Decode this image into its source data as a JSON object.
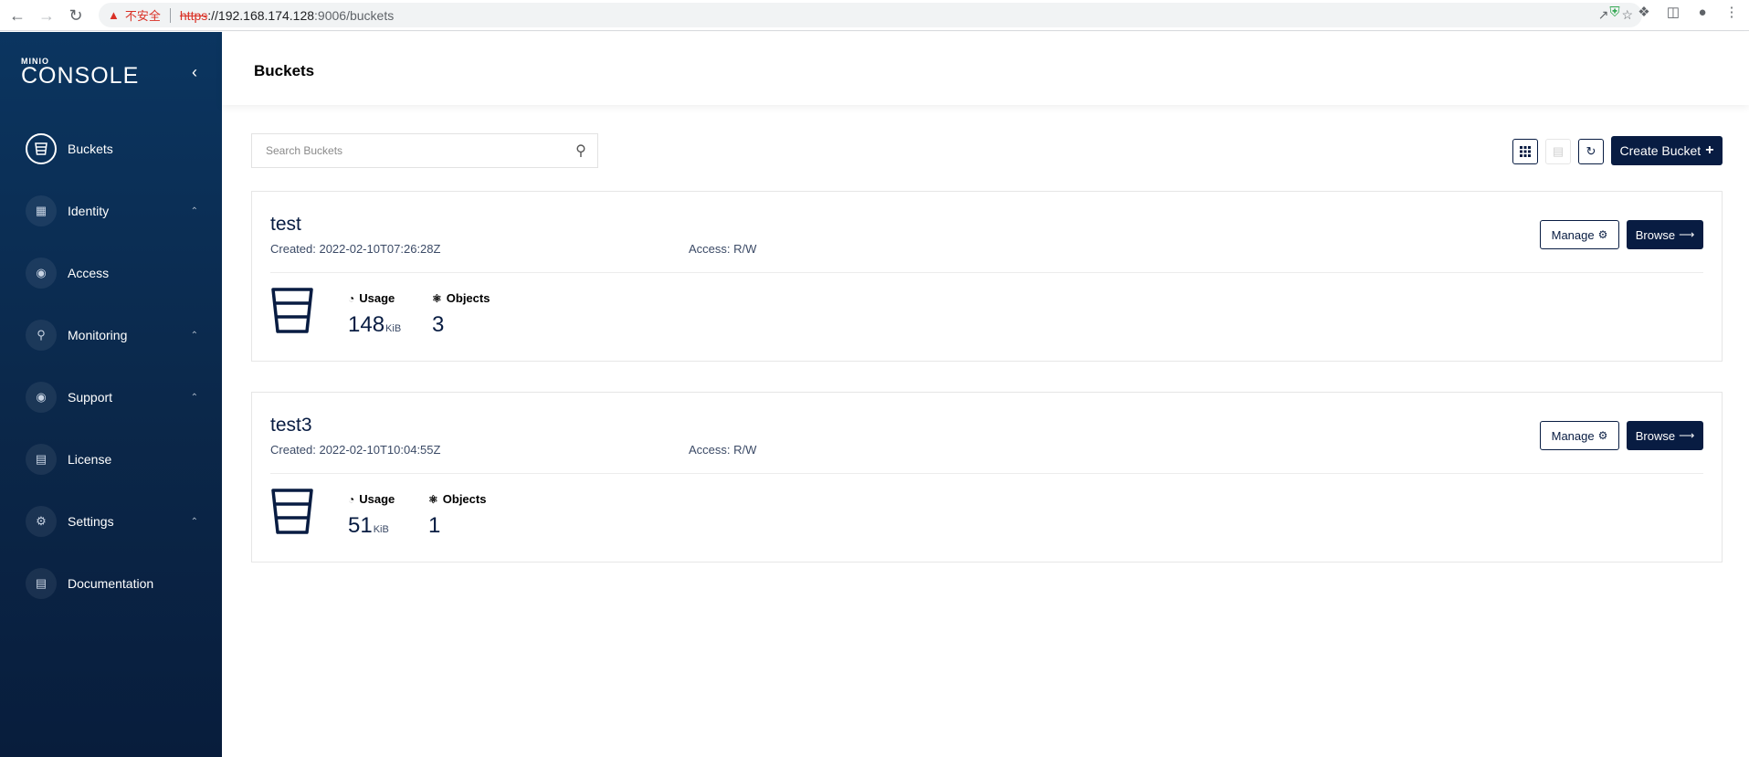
{
  "browser": {
    "insecure_label": "不安全",
    "url_scheme": "https",
    "url_host": "://192.168.174.128",
    "url_path": ":9006/buckets"
  },
  "sidebar": {
    "logo_small": "MINIO",
    "logo_big": "CONSOLE",
    "items": [
      {
        "label": "Buckets"
      },
      {
        "label": "Identity"
      },
      {
        "label": "Access"
      },
      {
        "label": "Monitoring"
      },
      {
        "label": "Support"
      },
      {
        "label": "License"
      },
      {
        "label": "Settings"
      },
      {
        "label": "Documentation"
      }
    ]
  },
  "header": {
    "title": "Buckets"
  },
  "toolbar": {
    "search_placeholder": "Search Buckets",
    "create_label": "Create Bucket"
  },
  "buckets": [
    {
      "name": "test",
      "created": "Created: 2022-02-10T07:26:28Z",
      "access": "Access: R/W",
      "manage_label": "Manage",
      "browse_label": "Browse",
      "usage_label": "Usage",
      "usage_value": "148",
      "usage_unit": "KiB",
      "objects_label": "Objects",
      "objects_value": "3"
    },
    {
      "name": "test3",
      "created": "Created: 2022-02-10T10:04:55Z",
      "access": "Access: R/W",
      "manage_label": "Manage",
      "browse_label": "Browse",
      "usage_label": "Usage",
      "usage_value": "51",
      "usage_unit": "KiB",
      "objects_label": "Objects",
      "objects_value": "1"
    }
  ],
  "colors": {
    "primary": "#081c42",
    "sidebar_top": "#0b3560",
    "sidebar_bottom": "#081d3c"
  }
}
